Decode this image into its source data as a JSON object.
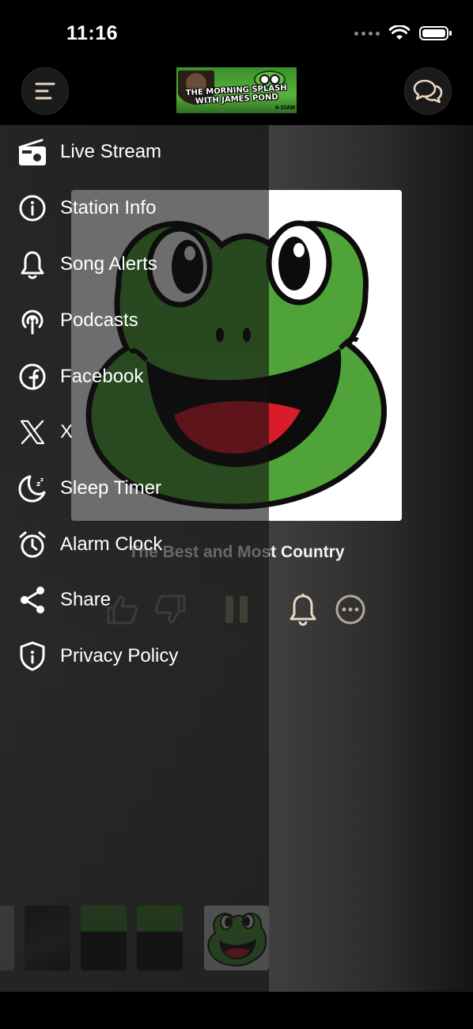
{
  "status_bar": {
    "time": "11:16"
  },
  "header": {
    "logo_text_line1": "THE MORNING SPLASH",
    "logo_text_line2": "WITH JAMES POND",
    "logo_hours": "6-10AM"
  },
  "now_playing": {
    "title": "The Best and Most Country"
  },
  "menu": {
    "items": [
      {
        "label": "Live Stream",
        "icon": "radio-icon"
      },
      {
        "label": "Station Info",
        "icon": "info-icon"
      },
      {
        "label": "Song Alerts",
        "icon": "bell-icon"
      },
      {
        "label": "Podcasts",
        "icon": "podcast-icon"
      },
      {
        "label": "Facebook",
        "icon": "facebook-icon"
      },
      {
        "label": "X",
        "icon": "x-logo-icon"
      },
      {
        "label": "Sleep Timer",
        "icon": "moon-icon"
      },
      {
        "label": "Alarm Clock",
        "icon": "alarm-clock-icon"
      },
      {
        "label": "Share",
        "icon": "share-icon"
      },
      {
        "label": "Privacy Policy",
        "icon": "shield-icon"
      }
    ]
  },
  "colors": {
    "accent": "#e9d8bf",
    "frog_green": "#4fa338",
    "tongue_red": "#d81c2a"
  }
}
